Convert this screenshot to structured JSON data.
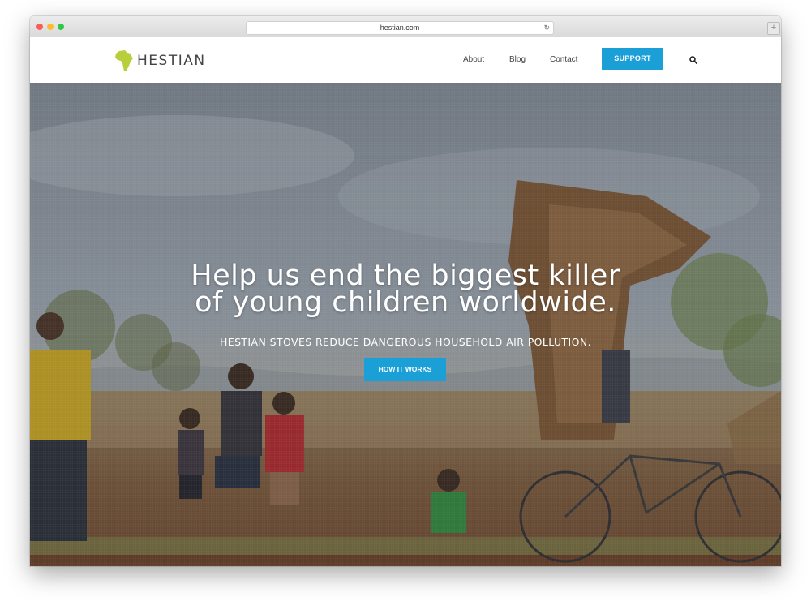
{
  "browser": {
    "url": "hestian.com",
    "newtab_label": "+"
  },
  "header": {
    "logo_text": "HESTIAN",
    "nav": {
      "about": "About",
      "blog": "Blog",
      "contact": "Contact"
    },
    "support_button": "SUPPORT"
  },
  "hero": {
    "title_line1": "Help us end the biggest killer",
    "title_line2": "of young children worldwide.",
    "subtitle": "HESTIAN STOVES REDUCE DANGEROUS HOUSEHOLD AIR POLLUTION.",
    "cta_button": "HOW IT WORKS"
  },
  "colors": {
    "accent": "#1a9fd6",
    "logo_green": "#b8cf3b",
    "nav_text": "#444444"
  },
  "icons": {
    "logo": "africa-map-icon",
    "search": "search-icon",
    "reload": "reload-icon"
  }
}
